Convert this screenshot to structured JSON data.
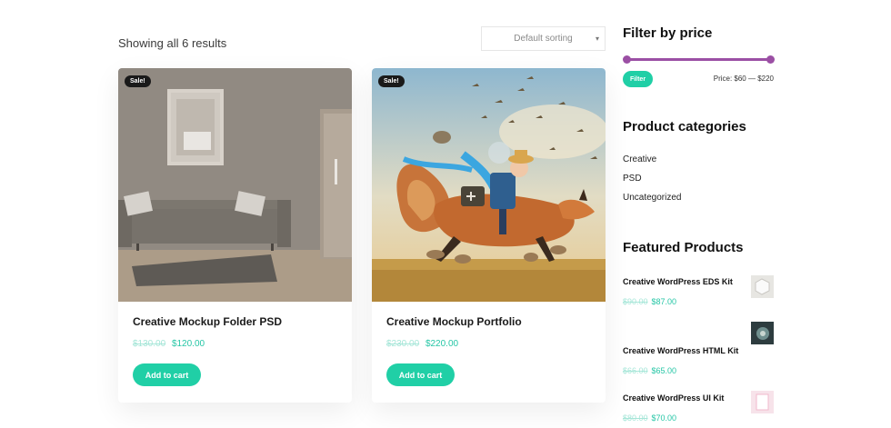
{
  "shop": {
    "result_count": "Showing all 6 results",
    "sorting": {
      "selected": "Default sorting",
      "icon": "chevron-down-icon"
    }
  },
  "products": [
    {
      "badge": "Sale!",
      "title": "Creative Mockup Folder PSD",
      "old_price": "$130.00",
      "price": "$120.00",
      "button": "Add to cart",
      "image": "living-room-sofa-photo"
    },
    {
      "badge": "Sale!",
      "title": "Creative Mockup Portfolio",
      "old_price": "$230.00",
      "price": "$220.00",
      "button": "Add to cart",
      "image": "boy-riding-fox-illustration"
    }
  ],
  "sidebar": {
    "filter": {
      "heading": "Filter by price",
      "button": "Filter",
      "price_range": "Price: $60 — $220"
    },
    "categories": {
      "heading": "Product categories",
      "items": [
        "Creative",
        "PSD",
        "Uncategorized"
      ]
    },
    "featured": {
      "heading": "Featured Products",
      "items": [
        {
          "name": "Creative WordPress EDS Kit",
          "old_price": "$90.00",
          "price": "$87.00"
        },
        {
          "name": "Creative WordPress HTML Kit",
          "old_price": "$66.00",
          "price": "$65.00"
        },
        {
          "name": "Creative WordPress UI Kit",
          "old_price": "$80.00",
          "price": "$70.00"
        }
      ]
    }
  },
  "colors": {
    "accent": "#20cfa6",
    "slider": "#9b4fa4",
    "badge": "#1a1a1a"
  }
}
